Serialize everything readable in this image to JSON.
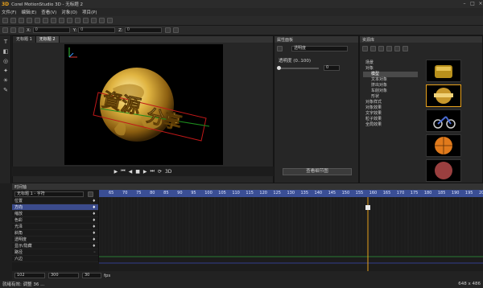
{
  "window": {
    "logo": "3D",
    "title": "Corel MotionStudio 3D - 无标题 2"
  },
  "menu": [
    "文件(F)",
    "编辑(E)",
    "查看(V)",
    "对象(O)",
    "项目(P)"
  ],
  "toolbar2": {
    "x_label": "X:",
    "x_value": "0",
    "y_label": "Y:",
    "y_value": "0",
    "z_label": "Z:",
    "z_value": "0"
  },
  "tabs": [
    {
      "label": "无标题 1"
    },
    {
      "label": "无标题 2"
    }
  ],
  "properties": {
    "title": "属性面板",
    "dropdown": "透明度",
    "label": "透明度 (0..100)",
    "value": "0",
    "button": "查看细节图"
  },
  "library": {
    "title": "资源库",
    "items": [
      {
        "label": "场景",
        "indent": 0
      },
      {
        "label": "对象",
        "indent": 0
      },
      {
        "label": "模型",
        "indent": 2,
        "selected": true
      },
      {
        "label": "文本对象",
        "indent": 2
      },
      {
        "label": "挤出对象",
        "indent": 2
      },
      {
        "label": "车削对象",
        "indent": 2
      },
      {
        "label": "形状",
        "indent": 2
      },
      {
        "label": "对象样式",
        "indent": 0
      },
      {
        "label": "对象效果",
        "indent": 0
      },
      {
        "label": "文字效果",
        "indent": 0
      },
      {
        "label": "粒子效果",
        "indent": 0
      },
      {
        "label": "全局效果",
        "indent": 0
      }
    ]
  },
  "playback": {
    "label_3d": "3D"
  },
  "timeline": {
    "title": "时间轴",
    "dropdown": "无标题 1 - 字符",
    "tracks": [
      {
        "label": "位置"
      },
      {
        "label": "方向",
        "selected": true
      },
      {
        "label": "缩放"
      },
      {
        "label": "色彩"
      },
      {
        "label": "光泽"
      },
      {
        "label": "斜角"
      },
      {
        "label": "透明度"
      },
      {
        "label": "显示/隐藏"
      },
      {
        "label": "路径"
      },
      {
        "label": "六边"
      }
    ],
    "ruler_ticks": [
      "65",
      "70",
      "75",
      "80",
      "85",
      "90",
      "95",
      "100",
      "105",
      "110",
      "115",
      "120",
      "125",
      "130",
      "135",
      "140",
      "145",
      "150",
      "155",
      "160",
      "165",
      "170",
      "175",
      "180",
      "185",
      "190",
      "195",
      "200"
    ],
    "frame_fields": {
      "current": "102",
      "total": "300",
      "fps_label": "fps",
      "fps_value": "30"
    }
  },
  "status": {
    "left": "就绪有效: 调整 36 ...",
    "right": "648 x 486"
  },
  "colors": {
    "accent": "#e9a21b",
    "ruler": "#3a4e95",
    "selected_track": "#3b4b8c"
  }
}
